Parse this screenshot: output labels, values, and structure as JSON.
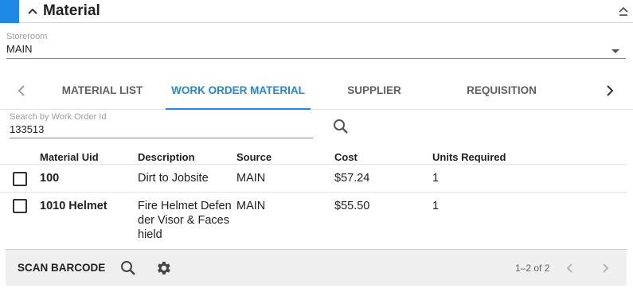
{
  "header": {
    "title": "Material"
  },
  "storeroom": {
    "label": "Storeroom",
    "value": "MAIN"
  },
  "tabs": [
    {
      "label": "MATERIAL LIST",
      "active": false
    },
    {
      "label": "WORK ORDER MATERIAL",
      "active": true
    },
    {
      "label": "SUPPLIER",
      "active": false
    },
    {
      "label": "REQUISITION",
      "active": false
    }
  ],
  "search": {
    "label": "Search by Work Order Id",
    "value": "133513"
  },
  "table": {
    "columns": [
      "Material Uid",
      "Description",
      "Source",
      "Cost",
      "Units Required"
    ],
    "rows": [
      {
        "uid": "100",
        "description": "Dirt to Jobsite",
        "source": "MAIN",
        "cost": "$57.24",
        "units": "1"
      },
      {
        "uid": "1010 Helmet",
        "description": "Fire Helmet Defender Visor & Faceshield",
        "source": "MAIN",
        "cost": "$55.50",
        "units": "1"
      }
    ]
  },
  "footer": {
    "scan_label": "SCAN BARCODE",
    "pager": "1–2 of 2"
  },
  "colors": {
    "accent": "#1e88e5",
    "footer_bg": "#efefef"
  },
  "icons": [
    "chevron-up-icon",
    "collapse-icon",
    "dropdown-caret-icon",
    "chevron-left-icon",
    "chevron-right-icon",
    "search-icon",
    "gear-icon",
    "checkbox-icon"
  ]
}
